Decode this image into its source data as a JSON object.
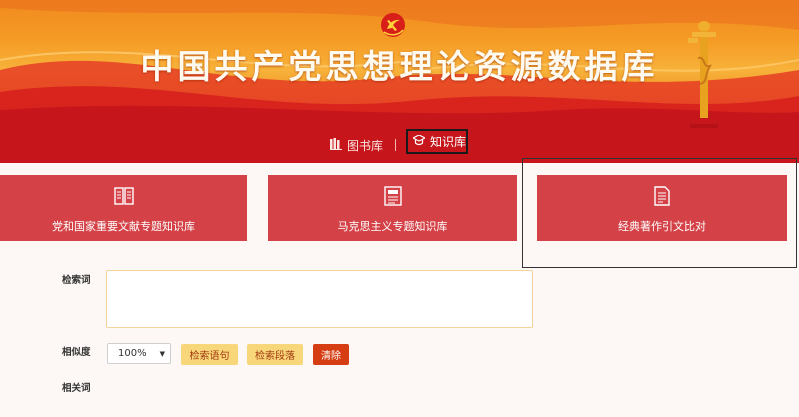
{
  "banner": {
    "title": "中国共产党思想理论资源数据库",
    "logo_icon": "party-emblem-icon",
    "monument_icon": "huabiao-column-icon"
  },
  "nav": {
    "books_label": "图书库",
    "books_icon": "books-icon",
    "separator": "|",
    "knowledge_label": "知识库",
    "knowledge_icon": "graduation-cap-icon"
  },
  "cards": [
    {
      "label": "党和国家重要文献专题知识库",
      "icon": "open-book-icon"
    },
    {
      "label": "马克思主义专题知识库",
      "icon": "document-icon"
    },
    {
      "label": "经典著作引文比对",
      "icon": "text-file-icon"
    }
  ],
  "form": {
    "keyword_label": "检索词",
    "keyword_value": "",
    "similarity_label": "相似度",
    "similarity_value": "100%",
    "search_sentence_label": "检索语句",
    "search_paragraph_label": "检索段落",
    "clear_label": "清除",
    "related_label": "相关词"
  },
  "colors": {
    "nav_band": "#c6161c",
    "card": "#d44247",
    "button_yellow": "#f8d67a",
    "button_clear": "#d63d12"
  }
}
